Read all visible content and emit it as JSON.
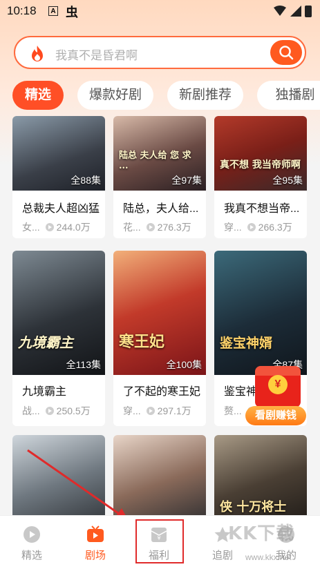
{
  "status_bar": {
    "time": "10:18",
    "sim_label": "A",
    "app_glyph": "虫"
  },
  "search": {
    "placeholder": "我真不是昏君啊"
  },
  "tabs": [
    {
      "label": "精选",
      "active": true
    },
    {
      "label": "爆款好剧",
      "active": false
    },
    {
      "label": "新剧推荐",
      "active": false
    },
    {
      "label": "独播剧",
      "active": false
    }
  ],
  "cards": [
    {
      "title": "总裁夫人超凶猛",
      "tag": "女...",
      "views": "244.0万",
      "episodes": "全88集",
      "poster_caption": ""
    },
    {
      "title": "陆总，夫人给...",
      "tag": "花...",
      "views": "276.3万",
      "episodes": "全97集",
      "poster_caption": "陆总 夫人给 您 求 ..."
    },
    {
      "title": "我真不想当帝...",
      "tag": "穿...",
      "views": "266.3万",
      "episodes": "全95集",
      "poster_caption": "真不想 我当帝师啊"
    },
    {
      "title": "九境霸主",
      "tag": "战...",
      "views": "250.5万",
      "episodes": "全113集",
      "poster_caption": "九境霸主"
    },
    {
      "title": "了不起的寒王妃",
      "tag": "穿...",
      "views": "297.1万",
      "episodes": "全100集",
      "poster_caption": "寒王妃"
    },
    {
      "title": "鉴宝神",
      "tag": "赘...",
      "views": "",
      "episodes": "全87集",
      "poster_caption": "鉴宝神婿"
    },
    {
      "title": "",
      "tag": "",
      "views": "",
      "episodes": "",
      "poster_caption": ""
    },
    {
      "title": "",
      "tag": "",
      "views": "",
      "episodes": "",
      "poster_caption": ""
    },
    {
      "title": "",
      "tag": "",
      "views": "",
      "episodes": "",
      "poster_caption": "侠 十万将士"
    }
  ],
  "float_promo": {
    "label": "看剧赚钱",
    "coin": "¥"
  },
  "bottom_nav": [
    {
      "label": "精选",
      "icon": "play-circle-icon",
      "active": false
    },
    {
      "label": "剧场",
      "icon": "tv-icon",
      "active": true
    },
    {
      "label": "福利",
      "icon": "gift-envelope-icon",
      "active": false
    },
    {
      "label": "追剧",
      "icon": "star-icon",
      "active": false
    },
    {
      "label": "我的",
      "icon": "profile-icon",
      "active": false
    }
  ],
  "watermark": {
    "brand": "KK下载",
    "url": "www.kkx.net"
  },
  "colors": {
    "accent": "#ff5a1f",
    "active_tab": "#ff4f26",
    "annotation_red": "#e02a2a"
  }
}
